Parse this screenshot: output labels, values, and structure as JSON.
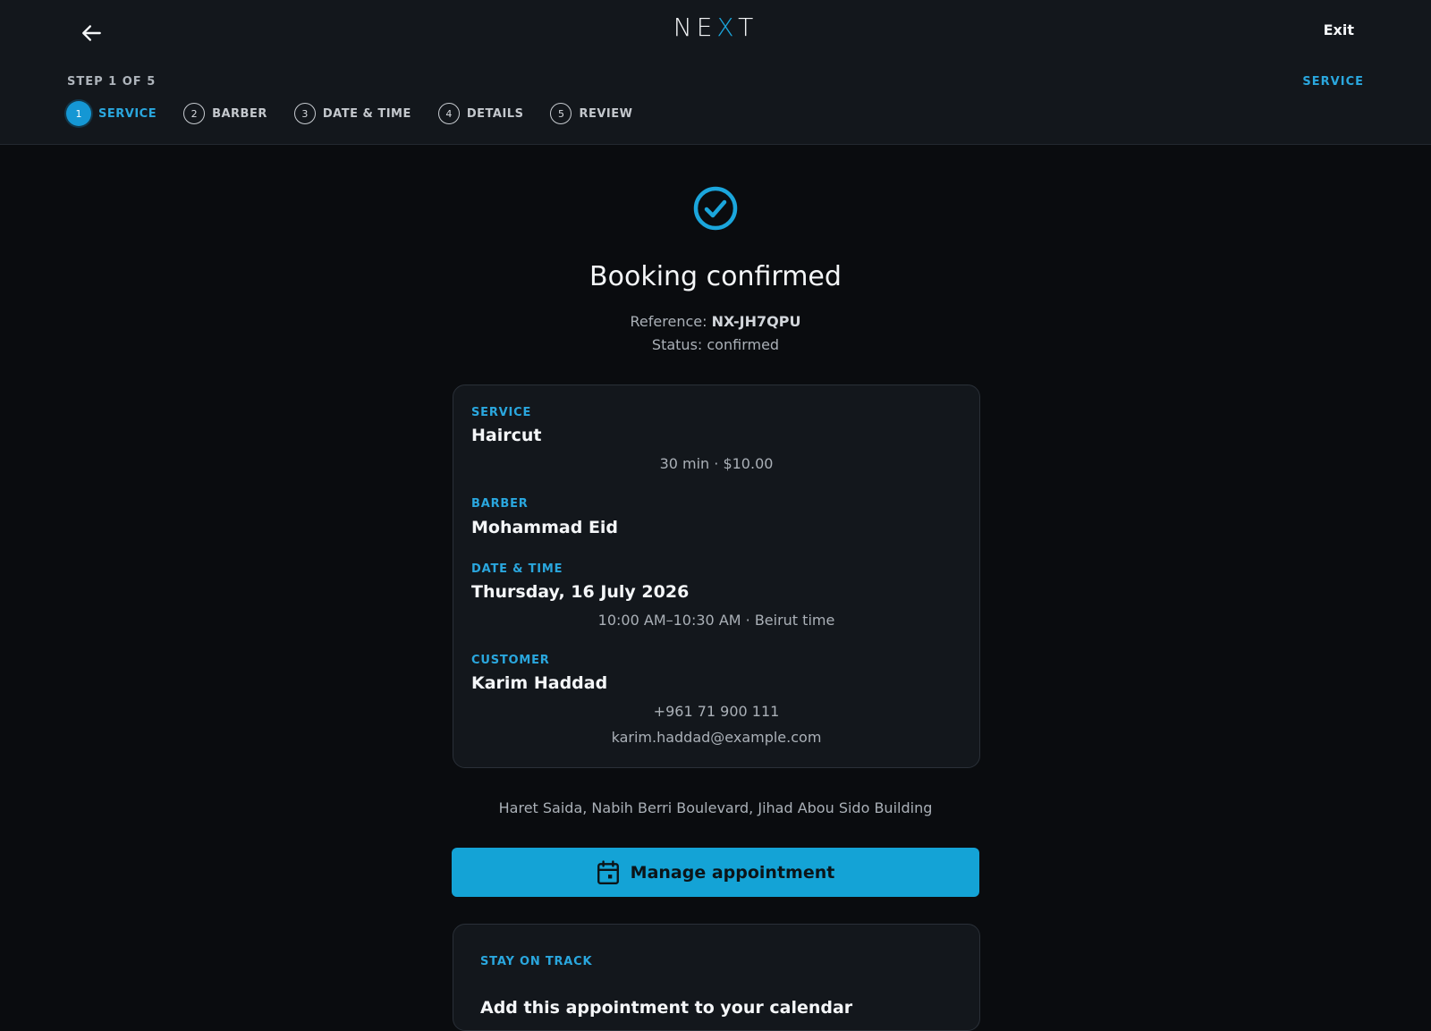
{
  "header": {
    "logo_left": "NE",
    "logo_accent": "X",
    "logo_right": "T",
    "exit_label": "Exit",
    "step_count": "STEP 1 OF 5",
    "current_step_label": "SERVICE",
    "steps": [
      {
        "num": "1",
        "label": "SERVICE"
      },
      {
        "num": "2",
        "label": "BARBER"
      },
      {
        "num": "3",
        "label": "DATE & TIME"
      },
      {
        "num": "4",
        "label": "DETAILS"
      },
      {
        "num": "5",
        "label": "REVIEW"
      }
    ]
  },
  "confirmation": {
    "title": "Booking confirmed",
    "reference_label": "Reference:",
    "reference_value": "NX-JH7QPU",
    "status": "Status: confirmed"
  },
  "summary": {
    "service_label": "SERVICE",
    "service_value": "Haircut",
    "service_meta": "30 min · $10.00",
    "barber_label": "BARBER",
    "barber_value": "Mohammad Eid",
    "datetime_label": "DATE & TIME",
    "datetime_value": "Thursday, 16 July 2026",
    "datetime_meta": "10:00 AM–10:30 AM · Beirut time",
    "customer_label": "CUSTOMER",
    "customer_name": "Karim Haddad",
    "customer_phone": "+961 71 900 111",
    "customer_email": "karim.haddad@example.com"
  },
  "address": "Haret Saida, Nabih Berri Boulevard, Jihad Abou Sido Building",
  "manage_button": "Manage appointment",
  "track": {
    "label": "STAY ON TRACK",
    "text": "Add this appointment to your calendar"
  },
  "colors": {
    "accent": "#1ba6dc",
    "background": "#0a0c0f",
    "surface": "#13171c"
  }
}
